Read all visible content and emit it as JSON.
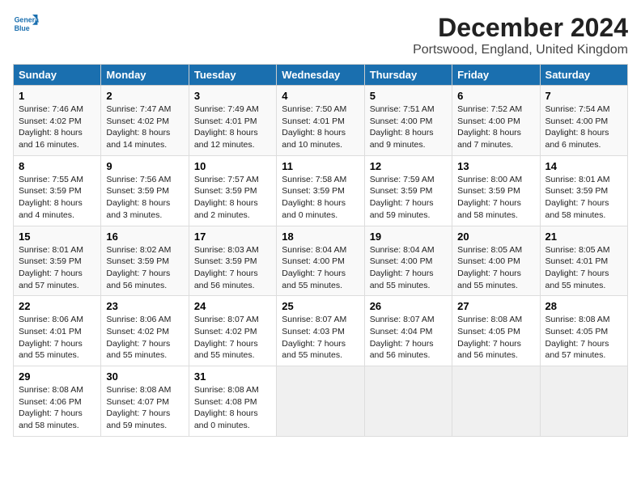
{
  "header": {
    "logo_line1": "General",
    "logo_line2": "Blue",
    "title": "December 2024",
    "subtitle": "Portswood, England, United Kingdom"
  },
  "columns": [
    "Sunday",
    "Monday",
    "Tuesday",
    "Wednesday",
    "Thursday",
    "Friday",
    "Saturday"
  ],
  "weeks": [
    [
      {
        "day": "1",
        "detail": "Sunrise: 7:46 AM\nSunset: 4:02 PM\nDaylight: 8 hours\nand 16 minutes."
      },
      {
        "day": "2",
        "detail": "Sunrise: 7:47 AM\nSunset: 4:02 PM\nDaylight: 8 hours\nand 14 minutes."
      },
      {
        "day": "3",
        "detail": "Sunrise: 7:49 AM\nSunset: 4:01 PM\nDaylight: 8 hours\nand 12 minutes."
      },
      {
        "day": "4",
        "detail": "Sunrise: 7:50 AM\nSunset: 4:01 PM\nDaylight: 8 hours\nand 10 minutes."
      },
      {
        "day": "5",
        "detail": "Sunrise: 7:51 AM\nSunset: 4:00 PM\nDaylight: 8 hours\nand 9 minutes."
      },
      {
        "day": "6",
        "detail": "Sunrise: 7:52 AM\nSunset: 4:00 PM\nDaylight: 8 hours\nand 7 minutes."
      },
      {
        "day": "7",
        "detail": "Sunrise: 7:54 AM\nSunset: 4:00 PM\nDaylight: 8 hours\nand 6 minutes."
      }
    ],
    [
      {
        "day": "8",
        "detail": "Sunrise: 7:55 AM\nSunset: 3:59 PM\nDaylight: 8 hours\nand 4 minutes."
      },
      {
        "day": "9",
        "detail": "Sunrise: 7:56 AM\nSunset: 3:59 PM\nDaylight: 8 hours\nand 3 minutes."
      },
      {
        "day": "10",
        "detail": "Sunrise: 7:57 AM\nSunset: 3:59 PM\nDaylight: 8 hours\nand 2 minutes."
      },
      {
        "day": "11",
        "detail": "Sunrise: 7:58 AM\nSunset: 3:59 PM\nDaylight: 8 hours\nand 0 minutes."
      },
      {
        "day": "12",
        "detail": "Sunrise: 7:59 AM\nSunset: 3:59 PM\nDaylight: 7 hours\nand 59 minutes."
      },
      {
        "day": "13",
        "detail": "Sunrise: 8:00 AM\nSunset: 3:59 PM\nDaylight: 7 hours\nand 58 minutes."
      },
      {
        "day": "14",
        "detail": "Sunrise: 8:01 AM\nSunset: 3:59 PM\nDaylight: 7 hours\nand 58 minutes."
      }
    ],
    [
      {
        "day": "15",
        "detail": "Sunrise: 8:01 AM\nSunset: 3:59 PM\nDaylight: 7 hours\nand 57 minutes."
      },
      {
        "day": "16",
        "detail": "Sunrise: 8:02 AM\nSunset: 3:59 PM\nDaylight: 7 hours\nand 56 minutes."
      },
      {
        "day": "17",
        "detail": "Sunrise: 8:03 AM\nSunset: 3:59 PM\nDaylight: 7 hours\nand 56 minutes."
      },
      {
        "day": "18",
        "detail": "Sunrise: 8:04 AM\nSunset: 4:00 PM\nDaylight: 7 hours\nand 55 minutes."
      },
      {
        "day": "19",
        "detail": "Sunrise: 8:04 AM\nSunset: 4:00 PM\nDaylight: 7 hours\nand 55 minutes."
      },
      {
        "day": "20",
        "detail": "Sunrise: 8:05 AM\nSunset: 4:00 PM\nDaylight: 7 hours\nand 55 minutes."
      },
      {
        "day": "21",
        "detail": "Sunrise: 8:05 AM\nSunset: 4:01 PM\nDaylight: 7 hours\nand 55 minutes."
      }
    ],
    [
      {
        "day": "22",
        "detail": "Sunrise: 8:06 AM\nSunset: 4:01 PM\nDaylight: 7 hours\nand 55 minutes."
      },
      {
        "day": "23",
        "detail": "Sunrise: 8:06 AM\nSunset: 4:02 PM\nDaylight: 7 hours\nand 55 minutes."
      },
      {
        "day": "24",
        "detail": "Sunrise: 8:07 AM\nSunset: 4:02 PM\nDaylight: 7 hours\nand 55 minutes."
      },
      {
        "day": "25",
        "detail": "Sunrise: 8:07 AM\nSunset: 4:03 PM\nDaylight: 7 hours\nand 55 minutes."
      },
      {
        "day": "26",
        "detail": "Sunrise: 8:07 AM\nSunset: 4:04 PM\nDaylight: 7 hours\nand 56 minutes."
      },
      {
        "day": "27",
        "detail": "Sunrise: 8:08 AM\nSunset: 4:05 PM\nDaylight: 7 hours\nand 56 minutes."
      },
      {
        "day": "28",
        "detail": "Sunrise: 8:08 AM\nSunset: 4:05 PM\nDaylight: 7 hours\nand 57 minutes."
      }
    ],
    [
      {
        "day": "29",
        "detail": "Sunrise: 8:08 AM\nSunset: 4:06 PM\nDaylight: 7 hours\nand 58 minutes."
      },
      {
        "day": "30",
        "detail": "Sunrise: 8:08 AM\nSunset: 4:07 PM\nDaylight: 7 hours\nand 59 minutes."
      },
      {
        "day": "31",
        "detail": "Sunrise: 8:08 AM\nSunset: 4:08 PM\nDaylight: 8 hours\nand 0 minutes."
      },
      null,
      null,
      null,
      null
    ]
  ]
}
